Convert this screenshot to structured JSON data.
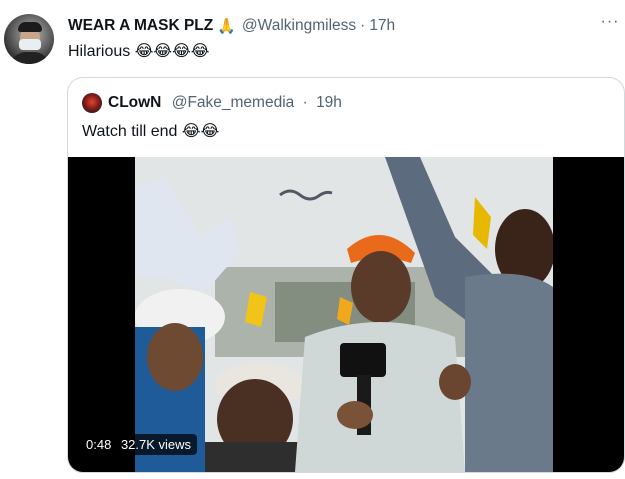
{
  "tweet": {
    "author_name": "WEAR A MASK PLZ",
    "author_badge_emoji": "🙏",
    "handle": "@Walkingmiless",
    "separator": "·",
    "time": "17h",
    "more_icon": "···",
    "text": "Hilarious 😂😂😂😂"
  },
  "quoted_tweet": {
    "author_name": "CLowN",
    "handle": "@Fake_memedia",
    "separator": "·",
    "time": "19h",
    "text": "Watch till end 😂😂",
    "video": {
      "duration": "0:48",
      "views": "32.7K views"
    }
  },
  "colors": {
    "text_primary": "#0f1419",
    "text_secondary": "#536471",
    "border": "#cfd9de"
  }
}
